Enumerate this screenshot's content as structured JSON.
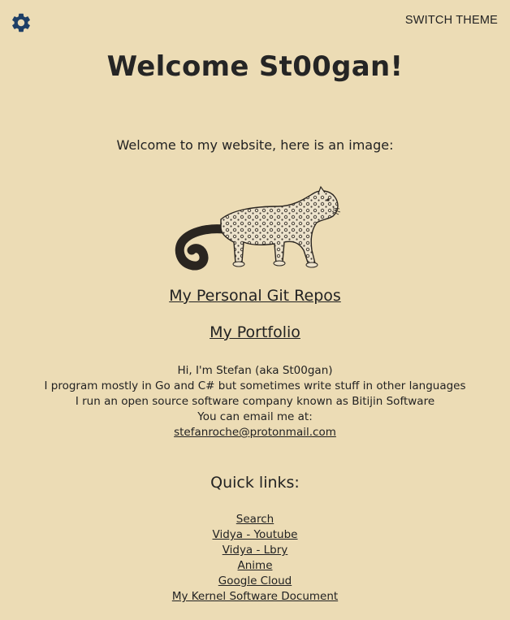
{
  "header": {
    "settings_icon": "gear-icon",
    "theme_button": "SWITCH THEME"
  },
  "title": "Welcome St00gan!",
  "intro": "Welcome to my website, here is an image:",
  "image": {
    "icon": "snow-leopard-illustration"
  },
  "links": {
    "git": "My Personal Git Repos",
    "portfolio": "My Portfolio"
  },
  "about": {
    "line1": "Hi, I'm Stefan (aka St00gan)",
    "line2": "I program mostly in Go and C# but sometimes write stuff in other languages",
    "line3": "I run an open source software company known as Bitijin Software",
    "line4": "You can email me at:",
    "email": "stefanroche@protonmail.com"
  },
  "quick_links": {
    "title": "Quick links:",
    "items": [
      "Search",
      "Vidya - Youtube",
      "Vidya - Lbry",
      "Anime",
      "Google Cloud",
      "My Kernel Software Document"
    ]
  },
  "colors": {
    "background": "#ecdcb5",
    "text": "#222222",
    "icon": "#1e3f66"
  }
}
